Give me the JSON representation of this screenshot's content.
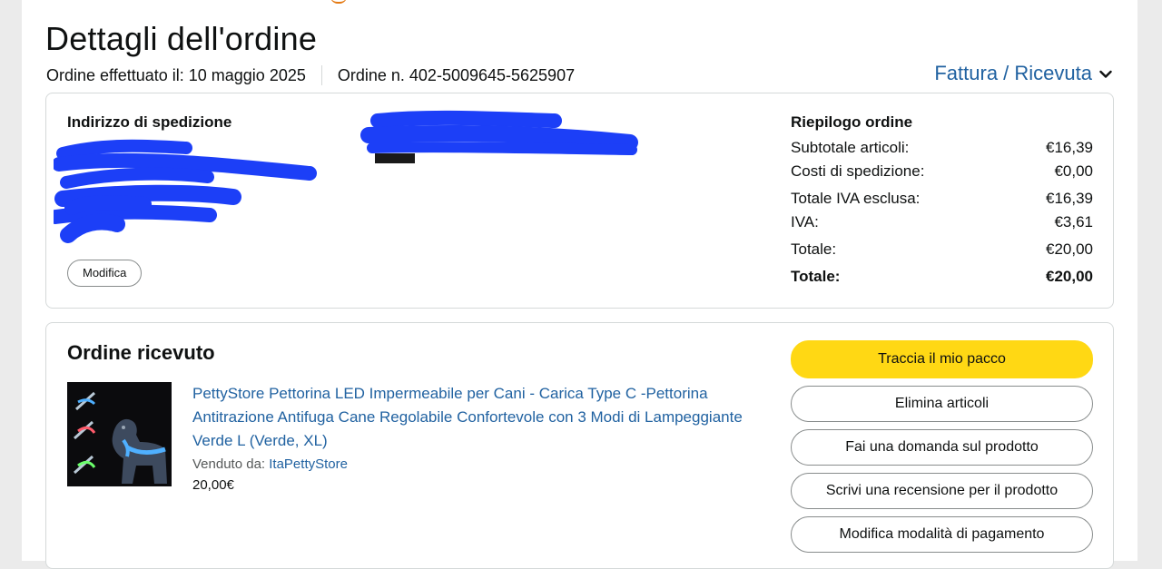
{
  "header": {
    "title": "Dettagli dell'ordine",
    "order_date": "Ordine effettuato il: 10 maggio 2025",
    "order_number": "Ordine n. 402-5009645-5625907",
    "invoice_link": "Fattura / Ricevuta"
  },
  "shipping": {
    "title": "Indirizzo di spedizione",
    "modify_label": "Modifica"
  },
  "summary": {
    "title": "Riepilogo ordine",
    "rows": [
      {
        "label": "Subtotale articoli:",
        "value": "€16,39"
      },
      {
        "label": "Costi di spedizione:",
        "value": "€0,00"
      },
      {
        "label": "Totale IVA esclusa:",
        "value": "€16,39"
      },
      {
        "label": "IVA:",
        "value": "€3,61"
      },
      {
        "label": "Totale:",
        "value": "€20,00"
      },
      {
        "label": "Totale:",
        "value": "€20,00"
      }
    ]
  },
  "order": {
    "status_title": "Ordine ricevuto",
    "product_title": "PettyStore Pettorina LED Impermeabile per Cani - Carica Type C -Pettorina Antitrazione Antifuga Cane Regolabile Confortevole con 3 Modi di Lampeggiante Verde L (Verde, XL)",
    "sold_by_label": "Venduto da:",
    "seller": "ItaPettyStore",
    "price": "20,00€"
  },
  "actions": {
    "track": "Traccia il mio pacco",
    "delete": "Elimina articoli",
    "question": "Fai una domanda sul prodotto",
    "review": "Scrivi una recensione per il prodotto",
    "payment": "Modifica modalità di pagamento"
  },
  "colors": {
    "link": "#2162a1",
    "primary_button": "#ffd814",
    "redaction": "#1c3ff7"
  }
}
